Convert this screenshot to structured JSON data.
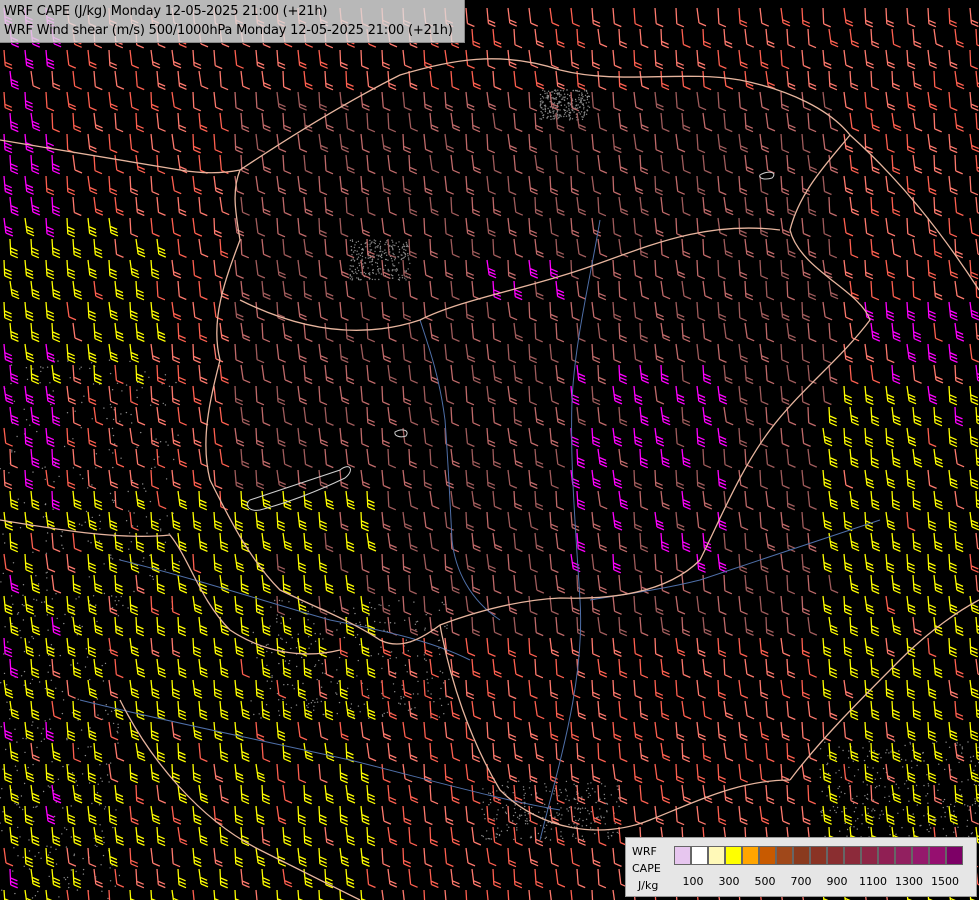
{
  "title": {
    "line1": "WRF CAPE (J/kg) Monday 12-05-2025 21:00 (+21h)",
    "line2": "WRF Wind shear (m/s) 500/1000hPa Monday 12-05-2025 21:00 (+21h)"
  },
  "legend": {
    "label_a": "WRF",
    "label_b": "CAPE",
    "label_c": "J/kg",
    "swatch_colors": [
      "#e7c6ef",
      "#ffffff",
      "#fff9b8",
      "#ffff00",
      "#ffa500",
      "#c85a00",
      "#a0481a",
      "#8a3a1e",
      "#8a3324",
      "#8a2e30",
      "#8c2a3a",
      "#8e2646",
      "#901f54",
      "#922060",
      "#951a6c",
      "#960f70",
      "#7d0066"
    ],
    "ticks": [
      "100",
      "300",
      "500",
      "700",
      "900",
      "1100",
      "1300",
      "1500"
    ]
  },
  "colors": {
    "background": "#000000",
    "border_country": "#e7b59e",
    "river": "#4f6fa8",
    "lake_edge": "#cfcfcf",
    "barb_palette": [
      "#ff00ff",
      "#ff7a6e",
      "#ff6050",
      "#c06a6a",
      "#a05c5c",
      "#ffff00",
      "#d6d600"
    ]
  }
}
